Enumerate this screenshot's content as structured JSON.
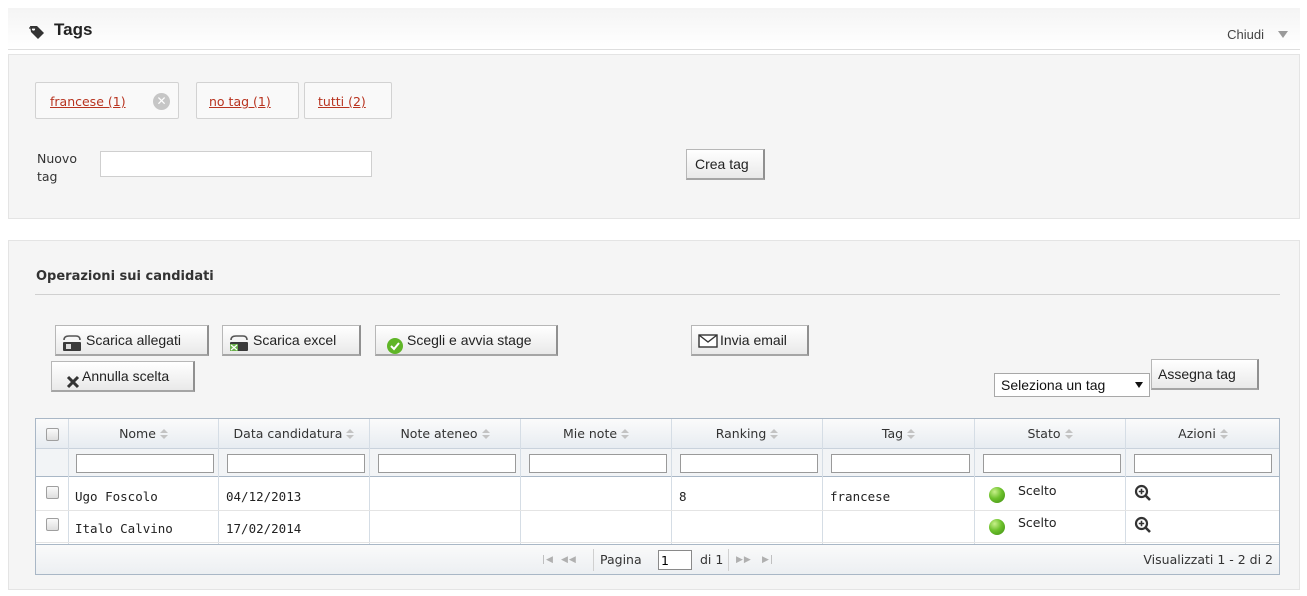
{
  "header": {
    "title": "Tags",
    "close_label": "Chiudi"
  },
  "tags_panel": {
    "chips": [
      {
        "label": "francese (1)",
        "removable": true
      },
      {
        "label": "no tag (1)",
        "removable": false
      },
      {
        "label": "tutti (2)",
        "removable": false
      }
    ],
    "chip_remove_glyph": "✕",
    "new_tag_label": "Nuovo tag",
    "new_tag_value": "",
    "create_button": "Crea tag"
  },
  "operations": {
    "title": "Operazioni sui candidati",
    "buttons": {
      "download_attachments": "Scarica allegati",
      "download_excel": "Scarica excel",
      "choose_start_stage": "Scegli e avvia stage",
      "send_email": "Invia email",
      "cancel_choice": "Annulla scelta",
      "assign_tag": "Assegna tag"
    },
    "tag_select": {
      "selected": "Seleziona un tag"
    },
    "icons": {
      "download_attachments": "paperclip-download-icon",
      "download_excel": "excel-download-icon",
      "choose_start_stage": "green-check-icon",
      "send_email": "envelope-icon",
      "cancel_choice": "x-icon"
    }
  },
  "grid": {
    "columns": [
      "Nome",
      "Data candidatura",
      "Note ateneo",
      "Mie note",
      "Ranking",
      "Tag",
      "Stato",
      "Azioni"
    ],
    "rows": [
      {
        "nome": "Ugo Foscolo",
        "data": "04/12/2013",
        "note_ateneo": "",
        "mie_note": "",
        "ranking": "8",
        "tag": "francese",
        "stato": "Scelto"
      },
      {
        "nome": "Italo Calvino",
        "data": "17/02/2014",
        "note_ateneo": "",
        "mie_note": "",
        "ranking": "",
        "tag": "",
        "stato": "Scelto"
      }
    ],
    "status_color": "#5fb527",
    "pager": {
      "page_label": "Pagina",
      "page_value": "1",
      "of_label": "di 1",
      "info": "Visualizzati 1 - 2 di 2",
      "nav_first": "|◀",
      "nav_prev": "◀◀",
      "nav_next": "▶▶",
      "nav_last": "▶|"
    }
  }
}
